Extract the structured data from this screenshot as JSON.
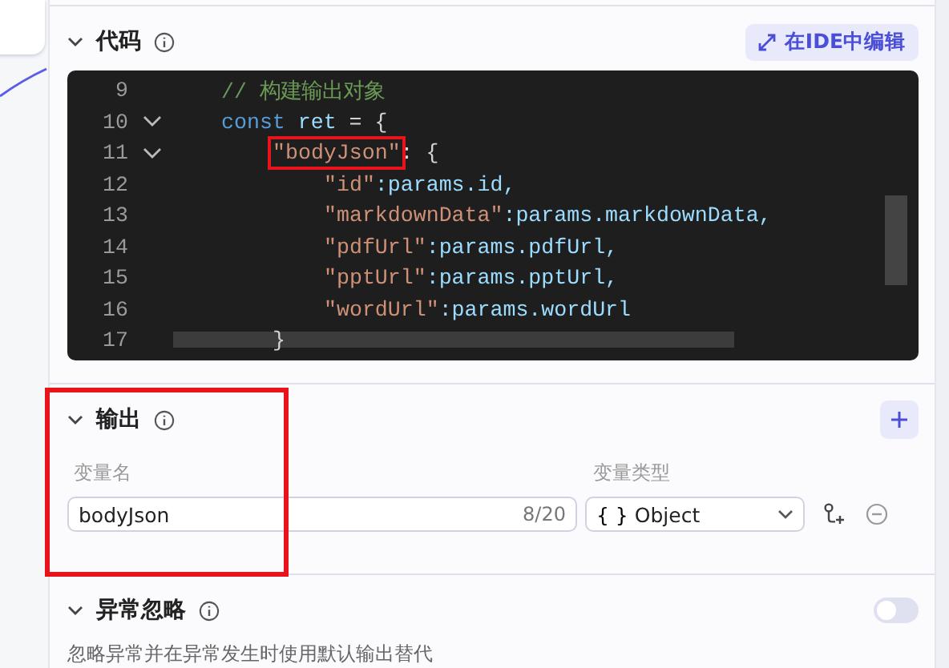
{
  "code_section": {
    "title": "代码",
    "expanded": true,
    "edit_button": "在IDE中编辑",
    "lines": [
      {
        "number": "9",
        "fold": false,
        "tokens": [
          {
            "kind": "comment",
            "text": "// 构建输出对象",
            "highlight": false
          }
        ]
      },
      {
        "number": "10",
        "fold": true,
        "tokens": [
          {
            "kind": "keyword",
            "text": "const",
            "highlight": false
          },
          {
            "kind": "ident",
            "text": " ret",
            "highlight": false
          },
          {
            "kind": "punct",
            "text": " = {",
            "highlight": false
          }
        ],
        "children": [
          {
            "number": "11",
            "fold": true,
            "tokens": [
              {
                "kind": "string",
                "text": "\"bodyJson\"",
                "highlight": true
              },
              {
                "kind": "punct",
                "text": ": {",
                "highlight": false
              }
            ],
            "children": [
              {
                "number": "12",
                "fold": false,
                "tokens": [
                  {
                    "kind": "string",
                    "text": "\"id\"",
                    "highlight": false
                  },
                  {
                    "kind": "ident",
                    "text": ":params.id,",
                    "highlight": false
                  }
                ]
              },
              {
                "number": "13",
                "fold": false,
                "tokens": [
                  {
                    "kind": "string",
                    "text": "\"markdownData\"",
                    "highlight": false
                  },
                  {
                    "kind": "ident",
                    "text": ":params.markdownData,",
                    "highlight": false
                  }
                ]
              },
              {
                "number": "14",
                "fold": false,
                "tokens": [
                  {
                    "kind": "string",
                    "text": "\"pdfUrl\"",
                    "highlight": false
                  },
                  {
                    "kind": "ident",
                    "text": ":params.pdfUrl,",
                    "highlight": false
                  }
                ]
              },
              {
                "number": "15",
                "fold": false,
                "tokens": [
                  {
                    "kind": "string",
                    "text": "\"pptUrl\"",
                    "highlight": false
                  },
                  {
                    "kind": "ident",
                    "text": ":params.pptUrl,",
                    "highlight": false
                  }
                ]
              },
              {
                "number": "16",
                "fold": false,
                "tokens": [
                  {
                    "kind": "string",
                    "text": "\"wordUrl\"",
                    "highlight": false
                  },
                  {
                    "kind": "ident",
                    "text": ":params.wordUrl",
                    "highlight": false
                  }
                ]
              }
            ]
          },
          {
            "number": "17",
            "fold": false,
            "tokens": [
              {
                "kind": "punct",
                "text": "}",
                "highlight": false
              }
            ]
          }
        ]
      }
    ]
  },
  "output_section": {
    "title": "输出",
    "expanded": true,
    "highlight": true,
    "name_label": "变量名",
    "type_label": "变量类型",
    "variables": [
      {
        "name": "bodyJson",
        "count": "8/20",
        "type_icon": "{ }",
        "type": "Object"
      }
    ]
  },
  "ignore_section": {
    "title": "异常忽略",
    "expanded": true,
    "on": false,
    "description": "忽略异常并在异常发生时使用默认输出替代"
  }
}
